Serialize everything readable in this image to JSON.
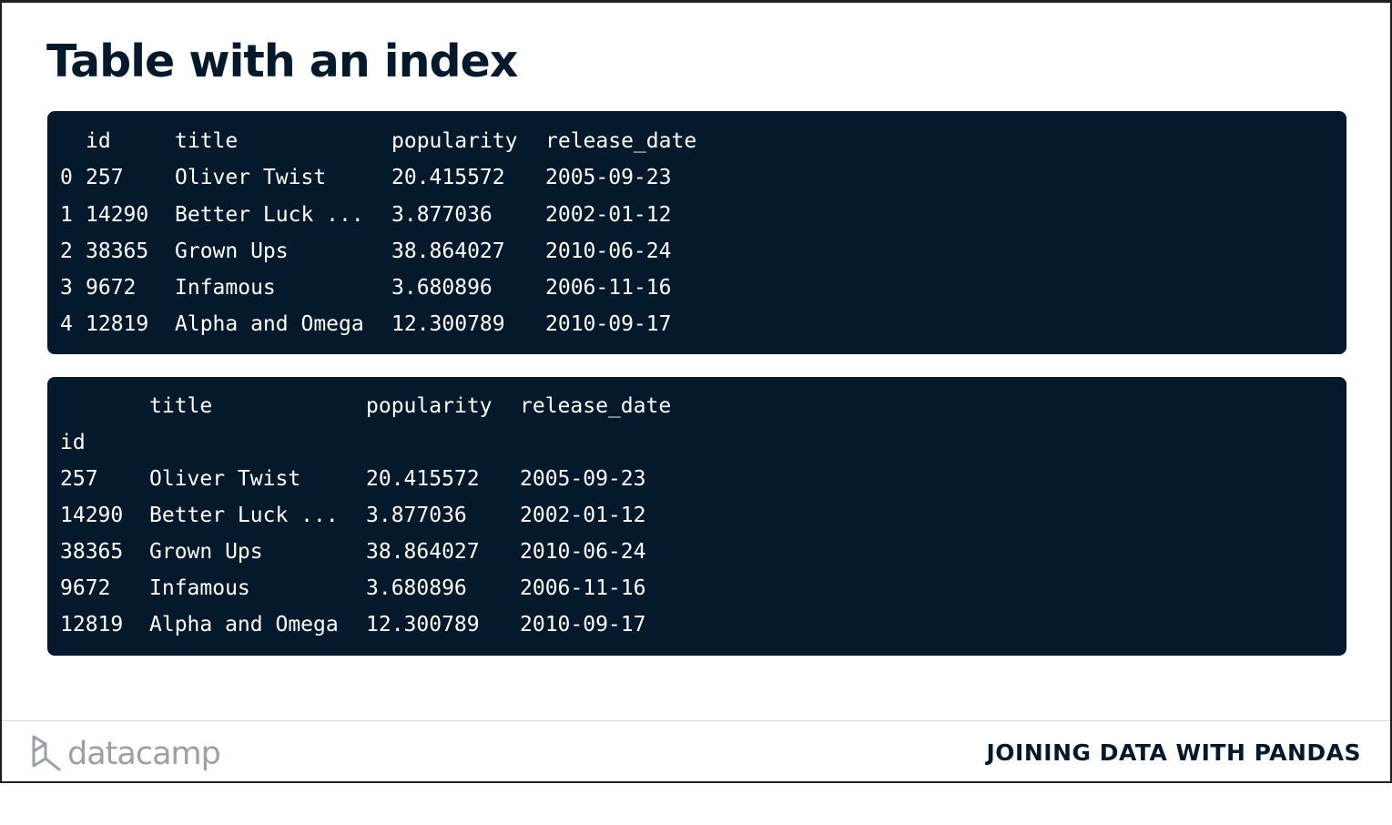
{
  "slide": {
    "title": "Table with an index"
  },
  "table1": {
    "headers": [
      "id",
      "title",
      "popularity",
      "release_date"
    ],
    "rows": [
      {
        "index": "0",
        "id": "257",
        "title": "Oliver Twist",
        "popularity": "20.415572",
        "release_date": "2005-09-23"
      },
      {
        "index": "1",
        "id": "14290",
        "title": "Better Luck ...",
        "popularity": "3.877036",
        "release_date": "2002-01-12"
      },
      {
        "index": "2",
        "id": "38365",
        "title": "Grown Ups",
        "popularity": "38.864027",
        "release_date": "2010-06-24"
      },
      {
        "index": "3",
        "id": "9672",
        "title": "Infamous",
        "popularity": "3.680896",
        "release_date": "2006-11-16"
      },
      {
        "index": "4",
        "id": "12819",
        "title": "Alpha and Omega",
        "popularity": "12.300789",
        "release_date": "2010-09-17"
      }
    ]
  },
  "table2": {
    "headers": [
      "title",
      "popularity",
      "release_date"
    ],
    "index_name": "id",
    "rows": [
      {
        "id": "257",
        "title": "Oliver Twist",
        "popularity": "20.415572",
        "release_date": "2005-09-23"
      },
      {
        "id": "14290",
        "title": "Better Luck ...",
        "popularity": "3.877036",
        "release_date": "2002-01-12"
      },
      {
        "id": "38365",
        "title": "Grown Ups",
        "popularity": "38.864027",
        "release_date": "2010-06-24"
      },
      {
        "id": "9672",
        "title": "Infamous",
        "popularity": "3.680896",
        "release_date": "2006-11-16"
      },
      {
        "id": "12819",
        "title": "Alpha and Omega",
        "popularity": "12.300789",
        "release_date": "2010-09-17"
      }
    ]
  },
  "footer": {
    "logo_text": "datacamp",
    "logo_icon": "datacamp-logo-icon",
    "course_name": "JOINING DATA WITH PANDAS"
  }
}
